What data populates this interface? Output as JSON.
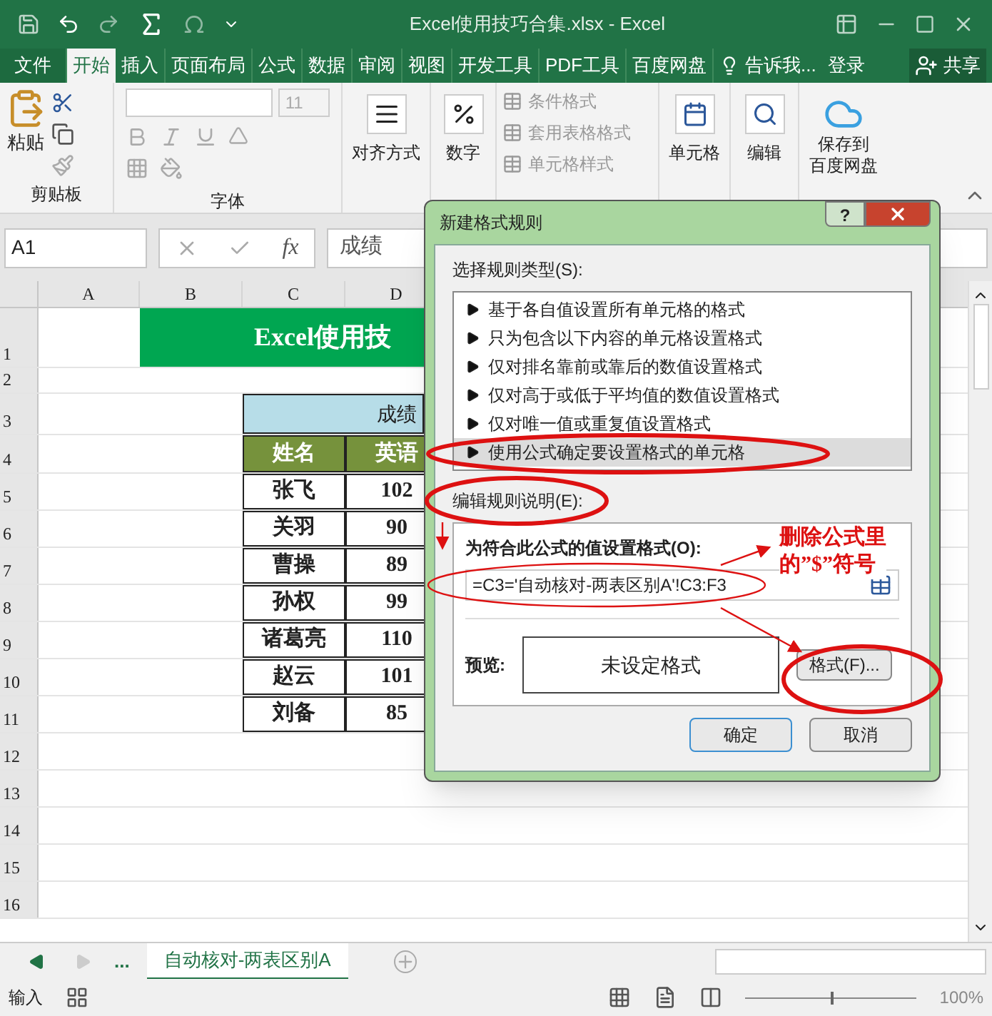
{
  "window": {
    "title": "Excel使用技巧合集.xlsx - Excel"
  },
  "ribbon_tabs": [
    {
      "label": "文件",
      "selected": false
    },
    {
      "label": "开始",
      "selected": true
    },
    {
      "label": "插入",
      "selected": false
    },
    {
      "label": "页面布局",
      "selected": false
    },
    {
      "label": "公式",
      "selected": false
    },
    {
      "label": "数据",
      "selected": false
    },
    {
      "label": "审阅",
      "selected": false
    },
    {
      "label": "视图",
      "selected": false
    },
    {
      "label": "开发工具",
      "selected": false
    },
    {
      "label": "PDF工具",
      "selected": false
    },
    {
      "label": "百度网盘",
      "selected": false
    }
  ],
  "tell_me": "告诉我...",
  "sign_in": "登录",
  "share": "共享",
  "ribbon": {
    "paste": "粘贴",
    "clipboard_label": "剪贴板",
    "font_size": "11",
    "font_label": "字体",
    "alignment": "对齐方式",
    "number": "数字",
    "styles": [
      {
        "label": "条件格式",
        "disabled": true
      },
      {
        "label": "套用表格格式",
        "disabled": true
      },
      {
        "label": "单元格样式",
        "disabled": true
      }
    ],
    "cells": "单元格",
    "editing": "编辑",
    "save_lines": [
      "保存到",
      "百度网盘"
    ]
  },
  "formula_bar": {
    "name_box": "A1",
    "fx_label": "fx",
    "content": "成绩"
  },
  "sheet": {
    "columns": [
      "A",
      "B",
      "C",
      "D"
    ],
    "row_numbers": [
      "1",
      "2",
      "3",
      "4",
      "5",
      "6",
      "7",
      "8",
      "9",
      "10",
      "11",
      "12",
      "13",
      "14",
      "15",
      "16"
    ],
    "banner": "Excel使用技",
    "table_title": "成绩",
    "headers": [
      "姓名",
      "英语"
    ],
    "rows": [
      [
        "张飞",
        "102"
      ],
      [
        "关羽",
        "90"
      ],
      [
        "曹操",
        "89"
      ],
      [
        "孙权",
        "99"
      ],
      [
        "诸葛亮",
        "110"
      ],
      [
        "赵云",
        "101"
      ],
      [
        "刘备",
        "85"
      ]
    ]
  },
  "dialog": {
    "title": "新建格式规则",
    "help": "?",
    "rule_type_label": "选择规则类型(S):",
    "rule_types": [
      {
        "label": "基于各自值设置所有单元格的格式",
        "selected": false
      },
      {
        "label": "只为包含以下内容的单元格设置格式",
        "selected": false
      },
      {
        "label": "仅对排名靠前或靠后的数值设置格式",
        "selected": false
      },
      {
        "label": "仅对高于或低于平均值的数值设置格式",
        "selected": false
      },
      {
        "label": "仅对唯一值或重复值设置格式",
        "selected": false
      },
      {
        "label": "使用公式确定要设置格式的单元格",
        "selected": true
      }
    ],
    "edit_label": "编辑规则说明(E):",
    "formula_label": "为符合此公式的值设置格式(O):",
    "formula": "=C3='自动核对-两表区别A'!C3:F3",
    "preview_label": "预览:",
    "preview": "未设定格式",
    "format_button": "格式(F)...",
    "ok": "确定",
    "cancel": "取消"
  },
  "annotation": {
    "lines": [
      "删除公式里",
      "的”$”符号"
    ]
  },
  "sheet_tabs": {
    "more": "...",
    "tabs": [
      {
        "label": "自动核对-两表区别A",
        "selected": true
      }
    ]
  },
  "status_bar": {
    "mode": "输入",
    "zoom": "100%",
    "level": 0.5
  }
}
